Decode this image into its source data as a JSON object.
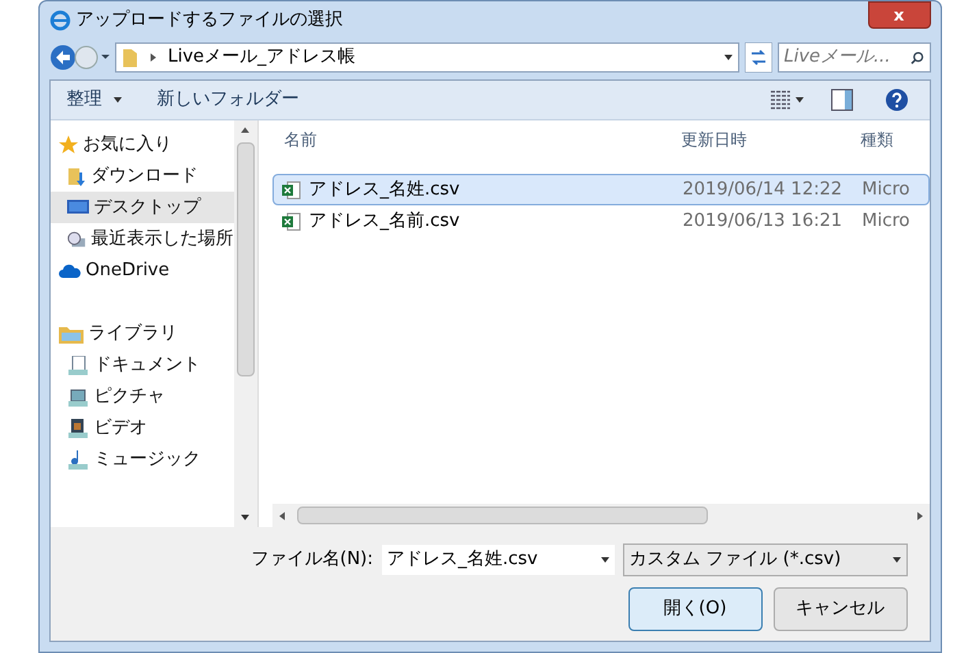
{
  "window": {
    "title": "アップロードするファイルの選択",
    "close": "x"
  },
  "address": {
    "path": "Liveメール_アドレス帳",
    "search_placeholder": "Liveメール..."
  },
  "toolbar": {
    "organize": "整理",
    "new_folder": "新しいフォルダー"
  },
  "sidebar": {
    "groups": [
      {
        "label": "お気に入り",
        "selected": false,
        "children": [
          {
            "label": "ダウンロード",
            "selected": false
          },
          {
            "label": "デスクトップ",
            "selected": true
          },
          {
            "label": "最近表示した場所",
            "selected": false
          }
        ]
      },
      {
        "label": "OneDrive",
        "selected": false
      },
      {
        "label": "ライブラリ",
        "selected": false,
        "children": [
          {
            "label": "ドキュメント",
            "selected": false
          },
          {
            "label": "ピクチャ",
            "selected": false
          },
          {
            "label": "ビデオ",
            "selected": false
          },
          {
            "label": "ミュージック",
            "selected": false
          }
        ]
      }
    ]
  },
  "table": {
    "columns": [
      "名前",
      "更新日時",
      "種類"
    ],
    "rows": [
      {
        "name": "アドレス_名姓.csv",
        "modified": "2019/06/14 12:22",
        "type": "Micro",
        "selected": true
      },
      {
        "name": "アドレス_名前.csv",
        "modified": "2019/06/13 16:21",
        "type": "Micro",
        "selected": false
      }
    ]
  },
  "footer": {
    "filename_label": "ファイル名(N):",
    "filename": "アドレス_名姓.csv",
    "filter": "カスタム ファイル (*.csv)",
    "open": "開く(O)",
    "cancel": "キャンセル"
  }
}
